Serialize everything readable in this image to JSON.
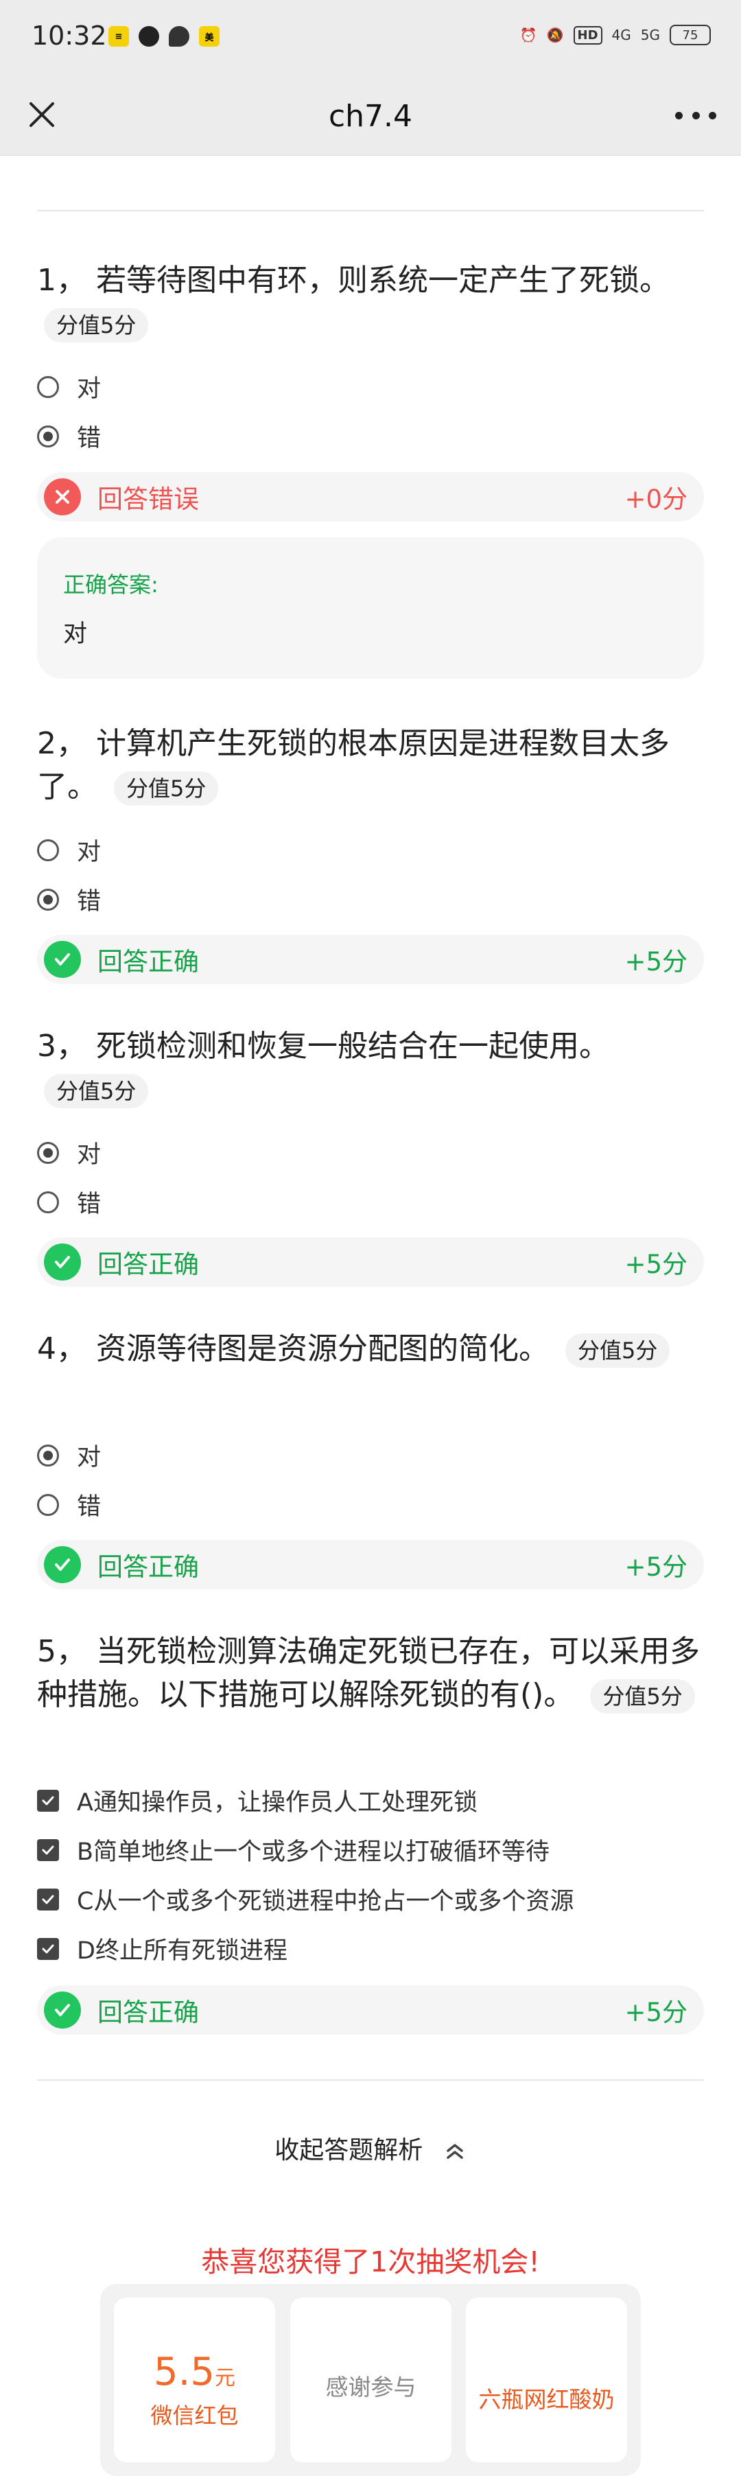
{
  "status_bar": {
    "time": "10:32",
    "hd": "HD",
    "net1": "4G",
    "net2": "5G",
    "battery": "75"
  },
  "nav": {
    "title": "ch7.4"
  },
  "questions": [
    {
      "text": "1， 若等待图中有环，则系统一定产生了死锁。",
      "score": "分值5分",
      "options": [
        "对",
        "错"
      ],
      "selected": 1,
      "result_label": "回答错误",
      "result_score": "+0分",
      "correct": false,
      "answer_label": "正确答案:",
      "answer_value": "对"
    },
    {
      "text": "2， 计算机产生死锁的根本原因是进程数目太多了。",
      "score": "分值5分",
      "options": [
        "对",
        "错"
      ],
      "selected": 1,
      "result_label": "回答正确",
      "result_score": "+5分",
      "correct": true
    },
    {
      "text": "3， 死锁检测和恢复一般结合在一起使用。",
      "score": "分值5分",
      "options": [
        "对",
        "错"
      ],
      "selected": 0,
      "result_label": "回答正确",
      "result_score": "+5分",
      "correct": true
    },
    {
      "text": "4， 资源等待图是资源分配图的简化。",
      "score": "分值5分",
      "options": [
        "对",
        "错"
      ],
      "selected": 0,
      "result_label": "回答正确",
      "result_score": "+5分",
      "correct": true
    },
    {
      "text": "5， 当死锁检测算法确定死锁已存在，可以采用多种措施。以下措施可以解除死锁的有()。",
      "score": "分值5分",
      "options": [
        "A通知操作员，让操作员人工处理死锁",
        "B简单地终止一个或多个进程以打破循环等待",
        "C从一个或多个死锁进程中抢占一个或多个资源",
        "D终止所有死锁进程"
      ],
      "checked": [
        true,
        true,
        true,
        true
      ],
      "result_label": "回答正确",
      "result_score": "+5分",
      "correct": true
    }
  ],
  "collapse_label": "收起答题解析",
  "lottery": {
    "title": "恭喜您获得了1次抽奖机会!",
    "prizes": [
      {
        "amount": "5.5",
        "unit": "元",
        "label": "微信红包"
      },
      {
        "label": "感谢参与"
      },
      {
        "label": "六瓶网红酸奶"
      }
    ]
  }
}
